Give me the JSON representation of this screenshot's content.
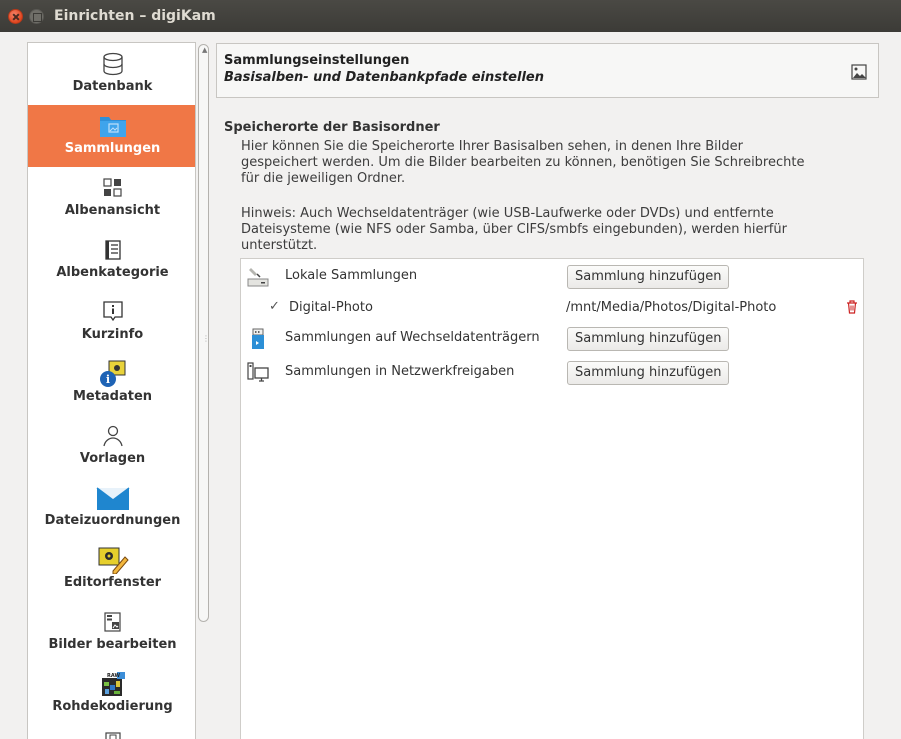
{
  "window": {
    "title": "Einrichten – digiKam"
  },
  "sidebar": {
    "items": [
      {
        "label": "Datenbank",
        "icon": "database-icon"
      },
      {
        "label": "Sammlungen",
        "icon": "folder-image-icon",
        "selected": true
      },
      {
        "label": "Albenansicht",
        "icon": "view-grid-icon"
      },
      {
        "label": "Albenkategorie",
        "icon": "list-document-icon"
      },
      {
        "label": "Kurzinfo",
        "icon": "info-box-icon"
      },
      {
        "label": "Metadaten",
        "icon": "metadata-info-icon"
      },
      {
        "label": "Vorlagen",
        "icon": "user-icon"
      },
      {
        "label": "Dateizuordnungen",
        "icon": "envelope-icon"
      },
      {
        "label": "Editorfenster",
        "icon": "image-edit-icon"
      },
      {
        "label": "Bilder bearbeiten",
        "icon": "image-document-icon"
      },
      {
        "label": "Rohdekodierung",
        "icon": "raw-decoding-icon"
      }
    ]
  },
  "header": {
    "title": "Sammlungseinstellungen",
    "subtitle": "Basisalben- und Datenbankpfade einstellen",
    "icon": "image-icon"
  },
  "section": {
    "title": "Speicherorte der Basisordner",
    "intro": [
      "Hier können Sie die Speicherorte Ihrer Basisalben sehen, in denen Ihre Bilder",
      "gespeichert werden. Um die Bilder bearbeiten zu können, benötigen Sie Schreibrechte",
      "für die jeweiligen Ordner."
    ],
    "note": [
      "Hinweis: Auch Wechseldatenträger (wie USB-Laufwerke oder DVDs) und entfernte",
      "Dateisysteme (wie NFS oder Samba, über CIFS/smbfs eingebunden), werden hierfür",
      "unterstützt."
    ]
  },
  "collections": {
    "local_label": "Lokale Sammlungen",
    "local_button": "Sammlung hinzufügen",
    "local_entry": {
      "name": "Digital-Photo",
      "path": "/mnt/Media/Photos/Digital-Photo"
    },
    "removable_label": "Sammlungen auf Wechseldatenträgern",
    "removable_button": "Sammlung hinzufügen",
    "network_label": "Sammlungen in Netzwerkfreigaben",
    "network_button": "Sammlung hinzufügen"
  },
  "colors": {
    "selected": "#f07746",
    "titlebar": "#3c3b37",
    "delete": "#cc2222"
  }
}
